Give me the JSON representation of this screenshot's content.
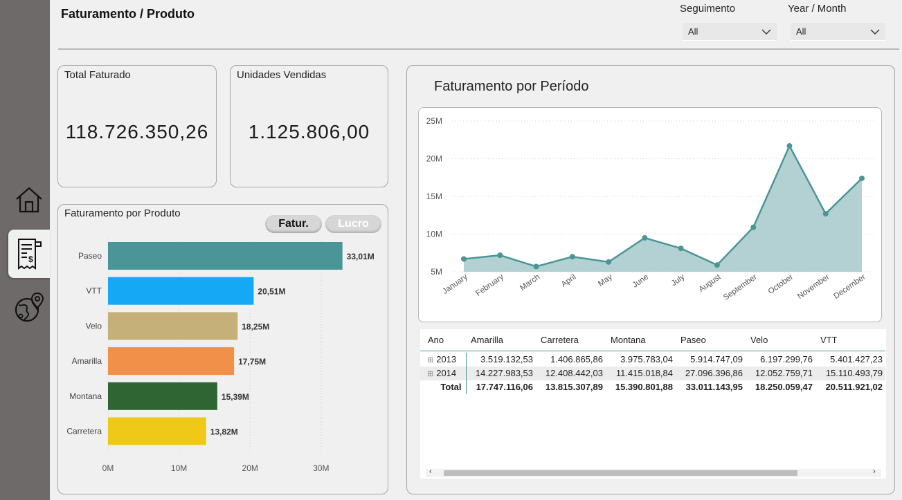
{
  "page": {
    "title": "Faturamento / Produto"
  },
  "filters": [
    {
      "label": "Seguimento",
      "value": "All"
    },
    {
      "label": "Year / Month",
      "value": "All"
    }
  ],
  "kpis": [
    {
      "title": "Total Faturado",
      "value": "118.726.350,26"
    },
    {
      "title": "Unidades Vendidas",
      "value": "1.125.806,00"
    }
  ],
  "bar_card": {
    "title": "Faturamento por Produto",
    "toggle_fatur": "Fatur.",
    "toggle_lucro": "Lucro"
  },
  "line_card": {
    "title": "Faturamento por Período"
  },
  "colors": {
    "teal": "#4a9597",
    "area": "#b3d1d2",
    "sidebar": "#6f6a6a"
  },
  "chart_data": [
    {
      "type": "bar",
      "orientation": "horizontal",
      "title": "Faturamento por Produto",
      "categories": [
        "Paseo",
        "VTT",
        "Velo",
        "Amarilla",
        "Montana",
        "Carretera"
      ],
      "values": [
        33.01,
        20.51,
        18.25,
        17.75,
        15.39,
        13.82
      ],
      "value_labels": [
        "33,01M",
        "20,51M",
        "18,25M",
        "17,75M",
        "15,39M",
        "13,82M"
      ],
      "colors": [
        "#4a9597",
        "#14a8f5",
        "#c5b07a",
        "#f19149",
        "#2e6532",
        "#eec918"
      ],
      "xticks": [
        "0M",
        "10M",
        "20M",
        "30M"
      ],
      "xlim": [
        0,
        34.5
      ]
    },
    {
      "type": "area",
      "title": "Faturamento por Período",
      "x": [
        "January",
        "February",
        "March",
        "April",
        "May",
        "June",
        "July",
        "August",
        "September",
        "October",
        "November",
        "December"
      ],
      "values": [
        6.7,
        7.2,
        5.7,
        7.0,
        6.3,
        9.5,
        8.1,
        5.9,
        10.9,
        21.7,
        12.7,
        17.4
      ],
      "yticks": [
        "5M",
        "10M",
        "15M",
        "20M",
        "25M"
      ],
      "ylim": [
        5,
        25
      ],
      "grid": true
    }
  ],
  "table": {
    "columns": [
      "Ano",
      "Amarilla",
      "Carretera",
      "Montana",
      "Paseo",
      "Velo",
      "VTT"
    ],
    "rows": [
      {
        "expand": "⊞",
        "label": "2013",
        "cells": [
          "3.519.132,53",
          "1.406.865,86",
          "3.975.783,04",
          "5.914.747,09",
          "6.197.299,76",
          "5.401.427,23"
        ]
      },
      {
        "expand": "⊞",
        "label": "2014",
        "cells": [
          "14.227.983,53",
          "12.408.442,03",
          "11.415.018,84",
          "27.096.396,86",
          "12.052.759,71",
          "15.110.493,79"
        ]
      }
    ],
    "total": {
      "label": "Total",
      "cells": [
        "17.747.116,06",
        "13.815.307,89",
        "15.390.801,88",
        "33.011.143,95",
        "18.250.059,47",
        "20.511.921,02"
      ]
    }
  }
}
